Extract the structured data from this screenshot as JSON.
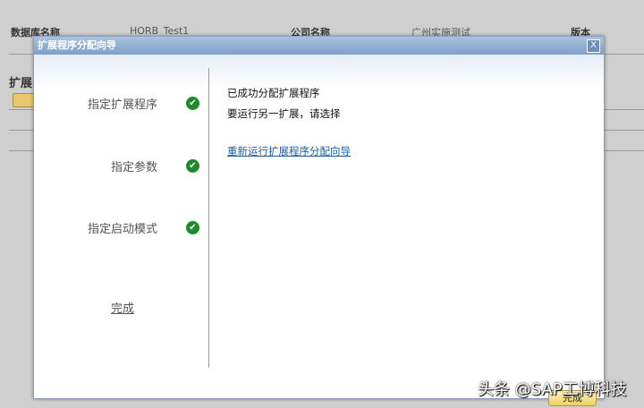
{
  "background": {
    "db_label": "数据库名称",
    "db_value": "HORB_Test1",
    "company_label": "公司名称",
    "company_value": "广州实施测试",
    "version_label": "版本",
    "section": "扩展"
  },
  "dialog": {
    "title": "扩展程序分配向导",
    "close": "X",
    "steps": [
      {
        "label": "指定扩展程序",
        "done": true
      },
      {
        "label": "指定参数",
        "done": true
      },
      {
        "label": "指定启动模式",
        "done": true
      }
    ],
    "current_step": "完成",
    "messages": [
      "已成功分配扩展程序",
      "要运行另一扩展，请选择"
    ],
    "rerun_link": "重新运行扩展程序分配向导",
    "finish_button": "完成",
    "check": "✔"
  },
  "watermark": "头条 @SAP工博科技"
}
